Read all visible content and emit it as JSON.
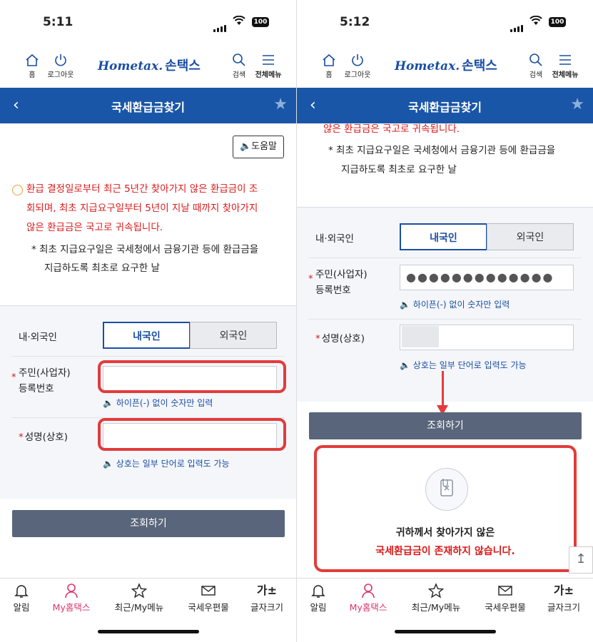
{
  "status": {
    "left_time": "5:11",
    "right_time": "5:12",
    "battery": "100"
  },
  "nav": {
    "home": "홈",
    "logout": "로그아웃",
    "search": "검색",
    "menu": "전체메뉴",
    "logo_home": "Hometax.",
    "logo_son": "손택스"
  },
  "page_title": "국세환급금찾기",
  "help_label": "도움말",
  "notice": {
    "line1": "환급 결정일로부터 최근 5년간 찾아가지 않은 환급금이 조",
    "line2": "회되며, 최초 지급요구일부터 5년이 지날 때까지 찾아가지",
    "line3": "않은 환급금은 국고로 귀속됩니다.",
    "note1": "* 최초 지급요구일은 국세청에서 금융기관 등에 환급금을",
    "note2": "지급하도록 최초로 요구한 날"
  },
  "form": {
    "nationality_label": "내·외국인",
    "domestic": "내국인",
    "foreign": "외국인",
    "id_label_1": "주민(사업자)",
    "id_label_2": "등록번호",
    "id_hint": "하이픈(-) 없이 숫자만 입력",
    "id_value_masked": "●●●●●●●●●●●●●",
    "name_label": "성명(상호)",
    "name_hint": "상호는 일부 단어로 입력도 가능",
    "submit": "조회하기"
  },
  "result": {
    "line1": "귀하께서 찾아가지 않은",
    "line2": "국세환급금이 존재하지 않습니다."
  },
  "bottom_nav": [
    {
      "label": "알림"
    },
    {
      "label": "My홈택스"
    },
    {
      "label": "최근/My메뉴"
    },
    {
      "label": "국세우편물"
    },
    {
      "label": "글자크기",
      "icon_text": "가±"
    }
  ],
  "colors": {
    "brand": "#1a56a8",
    "alert": "#d91a1a",
    "highlight": "#e33b3b",
    "active": "#d9356e"
  }
}
